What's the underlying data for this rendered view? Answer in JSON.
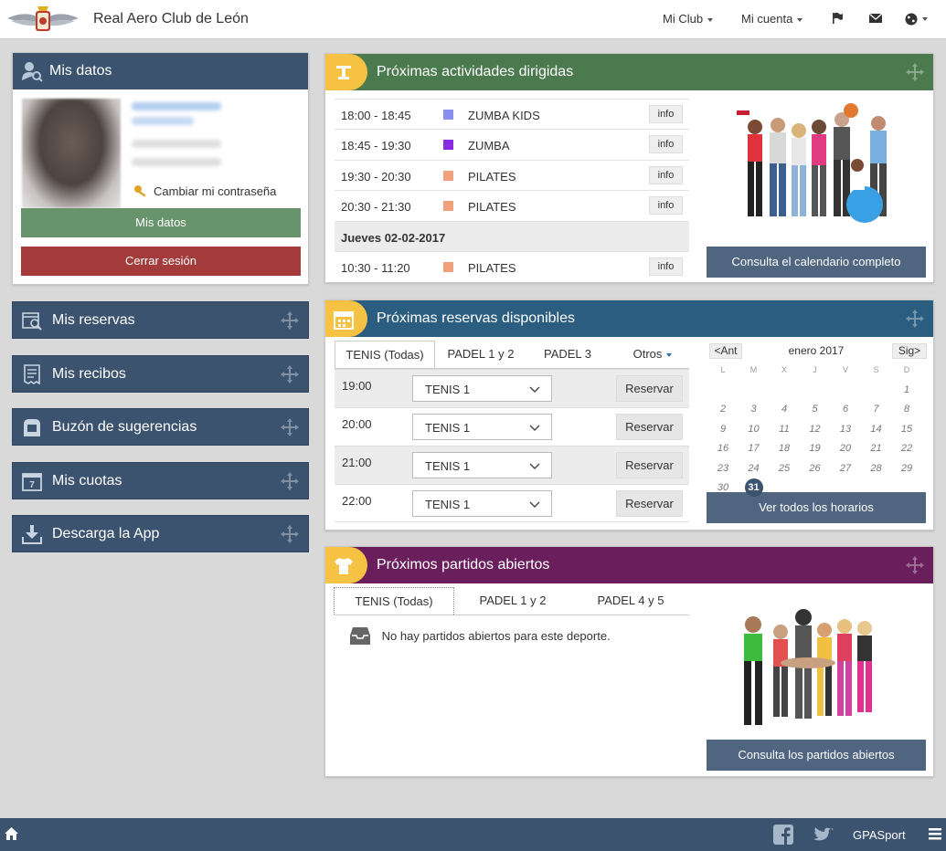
{
  "header": {
    "club_name": "Real Aero Club de León",
    "nav": {
      "club": "Mi Club",
      "account": "Mi cuenta"
    },
    "icons": [
      "flag-icon",
      "mail-icon",
      "globe-icon"
    ]
  },
  "profile": {
    "title": "Mis datos",
    "change_password": "Cambiar mi contraseña",
    "my_data_button": "Mis datos",
    "logout_button": "Cerrar sesión"
  },
  "sidebar": {
    "items": [
      {
        "label": "Mis reservas",
        "icon": "calendar-search-icon"
      },
      {
        "label": "Mis recibos",
        "icon": "receipt-icon"
      },
      {
        "label": "Buzón de sugerencias",
        "icon": "mailbox-icon"
      },
      {
        "label": "Mis cuotas",
        "icon": "calendar-7-icon"
      },
      {
        "label": "Descarga la App",
        "icon": "download-icon"
      }
    ]
  },
  "activities": {
    "title": "Próximas actividades dirigidas",
    "rows": [
      {
        "time": "18:00 - 18:45",
        "name": "ZUMBA KIDS",
        "color": "#8b8ff0",
        "info": "info"
      },
      {
        "time": "18:45 - 19:30",
        "name": "ZUMBA",
        "color": "#8a2be2",
        "info": "info"
      },
      {
        "time": "19:30 - 20:30",
        "name": "PILATES",
        "color": "#f0a07a",
        "info": "info"
      },
      {
        "time": "20:30 - 21:30",
        "name": "PILATES",
        "color": "#f0a07a",
        "info": "info"
      }
    ],
    "day_label": "Jueves 02-02-2017",
    "rows2": [
      {
        "time": "10:30 - 11:20",
        "name": "PILATES",
        "color": "#f0a07a",
        "info": "info"
      }
    ],
    "calendar_button": "Consulta el calendario completo"
  },
  "reservations": {
    "title": "Próximas reservas disponibles",
    "tabs": [
      "TENIS (Todas)",
      "PADEL 1 y 2",
      "PADEL 3",
      "Otros"
    ],
    "rows": [
      {
        "time": "19:00",
        "court": "TENIS 1",
        "action": "Reservar"
      },
      {
        "time": "20:00",
        "court": "TENIS 1",
        "action": "Reservar"
      },
      {
        "time": "21:00",
        "court": "TENIS 1",
        "action": "Reservar"
      },
      {
        "time": "22:00",
        "court": "TENIS 1",
        "action": "Reservar"
      }
    ],
    "calendar": {
      "prev": "<Ant",
      "next": "Sig>",
      "month": "enero 2017",
      "weekdays": [
        "L",
        "M",
        "X",
        "J",
        "V",
        "S",
        "D"
      ],
      "selected_day": "31"
    },
    "schedule_button": "Ver todos los horarios"
  },
  "matches": {
    "title": "Próximos partidos abiertos",
    "tabs": [
      "TENIS (Todas)",
      "PADEL 1 y 2",
      "PADEL 4 y 5"
    ],
    "empty_message": "No hay partidos abiertos para este deporte.",
    "button": "Consulta los partidos abiertos"
  },
  "footer": {
    "brand": "GPASport"
  }
}
